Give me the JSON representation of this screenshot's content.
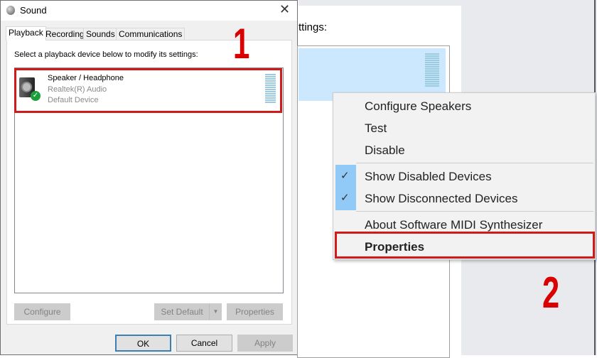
{
  "dialog": {
    "title": "Sound",
    "close_icon": "close-icon",
    "tabs": [
      {
        "label": "Playback",
        "active": true
      },
      {
        "label": "Recording"
      },
      {
        "label": "Sounds"
      },
      {
        "label": "Communications"
      }
    ],
    "instruction": "Select a playback device below to modify its settings:",
    "device": {
      "name": "Speaker / Headphone",
      "driver": "Realtek(R) Audio",
      "status": "Default Device",
      "icon": "speaker-icon",
      "badge": "green-check-icon"
    },
    "buttons": {
      "configure": "Configure",
      "set_default": "Set Default",
      "properties": "Properties",
      "ok": "OK",
      "cancel": "Cancel",
      "apply": "Apply"
    }
  },
  "right": {
    "instruction_fragment": "ttings:",
    "menu": {
      "items": [
        {
          "label": "Configure Speakers"
        },
        {
          "label": "Test"
        },
        {
          "label": "Disable"
        },
        {
          "label": "Show Disabled Devices",
          "checked": true
        },
        {
          "label": "Show Disconnected Devices",
          "checked": true
        },
        {
          "label": "About Software MIDI Synthesizer"
        },
        {
          "label": "Properties",
          "bold": true,
          "highlighted": true
        }
      ]
    }
  },
  "annotations": {
    "step1": "1",
    "step2": "2",
    "color": "#d11a1a"
  }
}
